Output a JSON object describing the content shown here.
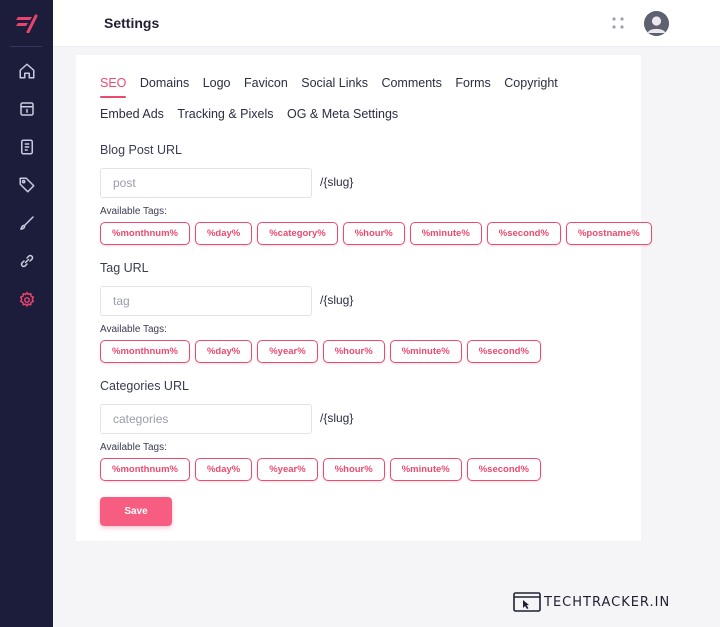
{
  "header": {
    "title": "Settings"
  },
  "sidebar": {
    "items": [
      {
        "icon": "home-icon"
      },
      {
        "icon": "calendar-icon"
      },
      {
        "icon": "document-icon"
      },
      {
        "icon": "tag-icon"
      },
      {
        "icon": "brush-icon"
      },
      {
        "icon": "link-icon"
      },
      {
        "icon": "gear-icon",
        "active": true
      }
    ]
  },
  "tabs": [
    "SEO",
    "Domains",
    "Logo",
    "Favicon",
    "Social Links",
    "Comments",
    "Forms",
    "Copyright",
    "Embed Ads",
    "Tracking & Pixels",
    "OG & Meta Settings"
  ],
  "active_tab": "SEO",
  "sections": {
    "blog_post": {
      "label": "Blog Post URL",
      "placeholder": "post",
      "suffix": "/{slug}",
      "available_label": "Available Tags:",
      "tags": [
        "%monthnum%",
        "%day%",
        "%category%",
        "%hour%",
        "%minute%",
        "%second%",
        "%postname%"
      ]
    },
    "tag": {
      "label": "Tag URL",
      "placeholder": "tag",
      "suffix": "/{slug}",
      "available_label": "Available Tags:",
      "tags": [
        "%monthnum%",
        "%day%",
        "%year%",
        "%hour%",
        "%minute%",
        "%second%"
      ]
    },
    "categories": {
      "label": "Categories URL",
      "placeholder": "categories",
      "suffix": "/{slug}",
      "available_label": "Available Tags:",
      "tags": [
        "%monthnum%",
        "%day%",
        "%year%",
        "%hour%",
        "%minute%",
        "%second%"
      ]
    }
  },
  "save_label": "Save",
  "watermark": {
    "text": "TECHTRACKER.IN"
  },
  "colors": {
    "accent": "#ea4b6f",
    "sidebar_bg": "#1c1d3b",
    "save_bg": "#f75c81"
  }
}
